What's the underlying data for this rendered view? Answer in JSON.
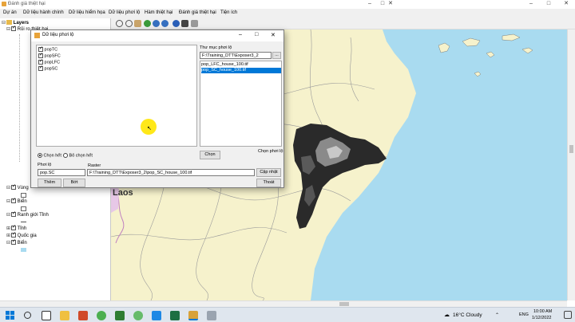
{
  "window": {
    "title": "Đánh giá thiệt hại",
    "controls": [
      "–",
      "□",
      "✕"
    ]
  },
  "menu": [
    "Dự án",
    "Dữ liệu hành chính",
    "Dữ liệu hiểm họa",
    "Dữ liệu phơi lộ",
    "Hàm thiệt hại",
    "Đánh giá thiệt hại",
    "Tiện ích"
  ],
  "toc": {
    "root": "Layers",
    "items": [
      {
        "label": "Rủi ro thiệt hại",
        "checked": true
      },
      {
        "label": "Vùng",
        "checked": true
      },
      {
        "label": "Biển",
        "checked": true
      },
      {
        "label": "Ranh giới Tỉnh",
        "checked": true
      },
      {
        "label": "Tỉnh",
        "checked": true
      },
      {
        "label": "Quốc gia",
        "checked": true
      },
      {
        "label": "Biển",
        "checked": true
      }
    ]
  },
  "map": {
    "label_laos": "Laos"
  },
  "dialog": {
    "title": "Dữ liệu phơi lộ",
    "layers": [
      "popTC",
      "popSFC",
      "popLFC",
      "popSC"
    ],
    "folder_label": "Thư mục phơi lộ",
    "folder_value": "F:\\Training_DTT\\Exposer3_2",
    "browse_label": "...",
    "files": [
      "pop_LFC_house_100.tif",
      "pop_SC_house_100.tif"
    ],
    "select_all": "Chọn hết",
    "deselect_all": "Bỏ chọn hết",
    "choose_btn": "Chọn",
    "choose_caption": "Chọn phơi lộ",
    "exposure_label": "Phơi lộ",
    "exposure_value": "pop.SC",
    "raster_label": "Raster",
    "raster_value": "F:\\Training_DTT\\Exposer3_2\\pop_SC_house_100.tif",
    "update_btn": "Cập nhật",
    "add_btn": "Thêm",
    "remove_btn": "Bớt",
    "exit_btn": "Thoát"
  },
  "taskbar": {
    "weather": "16°C Cloudy",
    "language": "ENG",
    "time": "10:00 AM",
    "date": "1/12/2022"
  },
  "colors": {
    "sea": "#a9dbf0",
    "land": "#f6f2cc",
    "border": "#9a9a9a",
    "highlight": "#ffe600",
    "select": "#0078d7"
  }
}
